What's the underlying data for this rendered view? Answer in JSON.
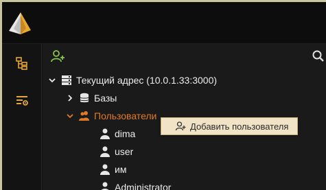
{
  "colors": {
    "accent_green": "#8ac44a",
    "accent_orange": "#e07a2a",
    "menu_bg": "#f1e3c6",
    "text": "#ececec"
  },
  "topbar": {
    "logo_icon": "app-logo-icon"
  },
  "leftrail": {
    "items": [
      {
        "name": "tree-icon"
      },
      {
        "name": "filter-settings-icon"
      }
    ]
  },
  "toolbar": {
    "add_user_icon": "add-user-icon",
    "search_icon": "search-icon"
  },
  "tree": {
    "root_label": "Текущий адрес (10.0.1.33:3000)",
    "databases_label": "Базы",
    "users_label": "Пользователи",
    "users": [
      {
        "label": "dima"
      },
      {
        "label": "user"
      },
      {
        "label": "им"
      },
      {
        "label": "Administrator"
      }
    ]
  },
  "context_menu": {
    "items": [
      {
        "label": "Добавить пользователя",
        "icon": "add-user-icon"
      }
    ]
  }
}
